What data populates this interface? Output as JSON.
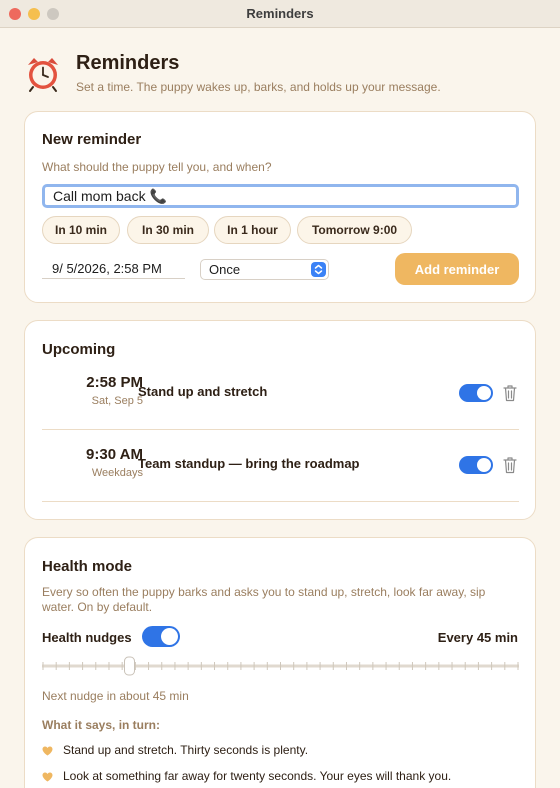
{
  "window": {
    "title": "Reminders"
  },
  "header": {
    "title": "Reminders",
    "subtitle": "Set a time. The puppy wakes up, barks, and holds up your message."
  },
  "new_reminder": {
    "title": "New reminder",
    "hint": "What should the puppy tell you, and when?",
    "message_value": "Call mom back 📞",
    "chips": [
      "In 10 min",
      "In 30 min",
      "In 1 hour",
      "Tomorrow 9:00"
    ],
    "date_value": "9/  5/2026,   2:58 PM",
    "repeat_value": "Once",
    "add_label": "Add reminder"
  },
  "upcoming": {
    "title": "Upcoming",
    "items": [
      {
        "time": "2:58 PM",
        "date": "Sat, Sep 5",
        "title": "Stand up and stretch",
        "enabled": true
      },
      {
        "time": "9:30 AM",
        "date": "Weekdays",
        "title": "Team standup — bring the roadmap",
        "enabled": true
      }
    ]
  },
  "health": {
    "title": "Health mode",
    "description": "Every so often the puppy barks and asks you to stand up, stretch, look far away, sip water. On by default.",
    "nudges_label": "Health nudges",
    "nudges_enabled": true,
    "interval_label": "Every 45 min",
    "next_nudge": "Next nudge in about 45 min",
    "says_title": "What it says, in turn:",
    "tips": [
      "Stand up and stretch. Thirty seconds is plenty.",
      "Look at something far away for twenty seconds. Your eyes will thank you."
    ]
  },
  "colors": {
    "accent": "#2f74e6",
    "add_button": "#efb761",
    "muted_text": "#9a7e5f",
    "heart": "#efb761"
  }
}
